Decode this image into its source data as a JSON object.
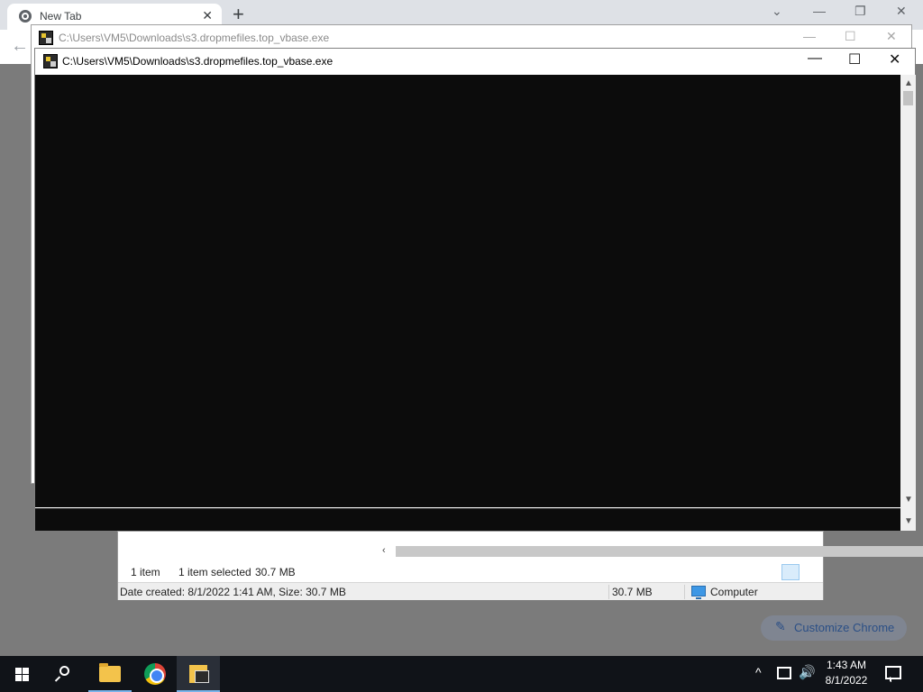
{
  "browser": {
    "tab_title": "New Tab",
    "tab_close": "✕",
    "new_tab": "+",
    "controls": {
      "tab_search": "⌄",
      "minimize": "—",
      "restore": "❐",
      "close": "✕"
    },
    "back": "←",
    "customize_label": "Customize Chrome"
  },
  "console_back": {
    "title": "C:\\Users\\VM5\\Downloads\\s3.dropmefiles.top_vbase.exe",
    "minimize": "—",
    "maximize": "☐",
    "close": "✕"
  },
  "console": {
    "title": "C:\\Users\\VM5\\Downloads\\s3.dropmefiles.top_vbase.exe",
    "minimize": "—",
    "maximize": "☐",
    "close": "✕",
    "scroll_up": "▲",
    "scroll_down": "▼"
  },
  "explorer": {
    "items_count": "1 item",
    "selected": "1 item selected",
    "selected_size": "30.7 MB",
    "details": "Date created: 8/1/2022 1:41 AM, Size: 30.7 MB",
    "size": "30.7 MB",
    "location": "Computer",
    "scroll_left": "‹",
    "scroll_right": "›"
  },
  "taskbar": {
    "tray_chevron": "^",
    "volume": "🔊",
    "time": "1:43 AM",
    "date": "8/1/2022"
  },
  "icons": [
    "chrome-icon",
    "folder-icon",
    "exe-icon",
    "search-icon",
    "windows-icon",
    "network-icon",
    "volume-icon",
    "notification-icon",
    "computer-icon"
  ]
}
